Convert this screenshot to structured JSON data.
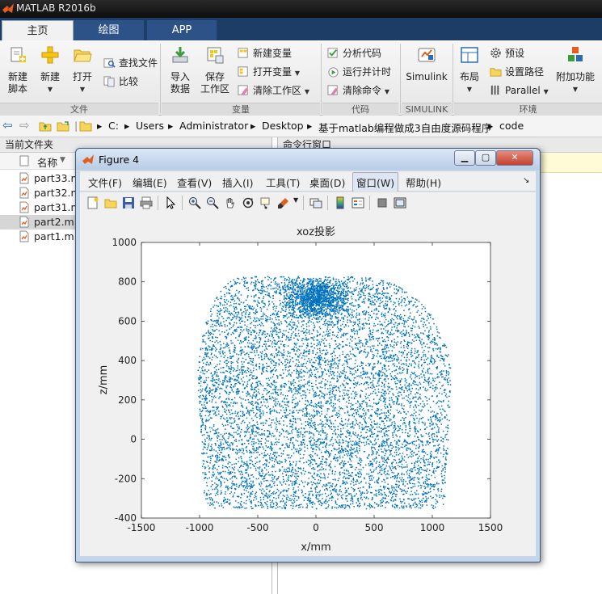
{
  "app": {
    "title": "MATLAB R2016b",
    "accent": "#1e3d66"
  },
  "ribbon": {
    "tabs": [
      {
        "label": "主页"
      },
      {
        "label": "绘图"
      },
      {
        "label": "APP"
      }
    ],
    "file_group": {
      "label": "文件",
      "new_script": "新建\n脚本",
      "new": "新建",
      "open": "打开",
      "find_files": "查找文件",
      "compare": "比较"
    },
    "variable_group": {
      "label": "变量",
      "import_data": "导入\n数据",
      "save_workspace": "保存\n工作区",
      "new_variable": "新建变量",
      "open_variable": "打开变量",
      "clear_workspace": "清除工作区"
    },
    "code_group": {
      "label": "代码",
      "analyze": "分析代码",
      "run_time": "运行并计时",
      "clear_commands": "清除命令"
    },
    "simulink_group": {
      "label": "SIMULINK",
      "simulink": "Simulink"
    },
    "env_group": {
      "label": "环境",
      "layout": "布局",
      "preferences": "预设",
      "set_path": "设置路径",
      "parallel": "Parallel",
      "addons": "附加功能"
    }
  },
  "path": {
    "segments": [
      "C:",
      "Users",
      "Administrator",
      "Desktop",
      "基于matlab编程做成3自由度源码程序",
      "code"
    ]
  },
  "current_folder": {
    "title": "当前文件夹",
    "column_name": "名称",
    "files": [
      {
        "name": "part33.m",
        "selected": false
      },
      {
        "name": "part32.m",
        "selected": false
      },
      {
        "name": "part31.m",
        "selected": false
      },
      {
        "name": "part2.m",
        "selected": true
      },
      {
        "name": "part1.m",
        "selected": false
      }
    ]
  },
  "command_window": {
    "title": "命令行窗口"
  },
  "figure": {
    "title": "Figure 4",
    "menus": [
      "文件(F)",
      "编辑(E)",
      "查看(V)",
      "插入(I)",
      "工具(T)",
      "桌面(D)",
      "窗口(W)",
      "帮助(H)"
    ],
    "active_menu": "窗口(W)"
  },
  "chart_data": {
    "type": "scatter",
    "title": "xoz投影",
    "xlabel": "x/mm",
    "ylabel": "z/mm",
    "xlim": [
      -1500,
      1500
    ],
    "ylim": [
      -400,
      1000
    ],
    "xticks": [
      -1500,
      -1000,
      -500,
      0,
      500,
      1000,
      1500
    ],
    "yticks": [
      -400,
      -200,
      0,
      200,
      400,
      600,
      800,
      1000
    ],
    "grid": false,
    "marker_color": "#0072bd",
    "point_count": 9000,
    "cloud_extent": {
      "x_range": [
        -1020,
        1160
      ],
      "z_range": [
        -350,
        830
      ],
      "top_x_range": [
        -630,
        370
      ],
      "dense_region": {
        "x": 0,
        "z": 720
      }
    }
  }
}
